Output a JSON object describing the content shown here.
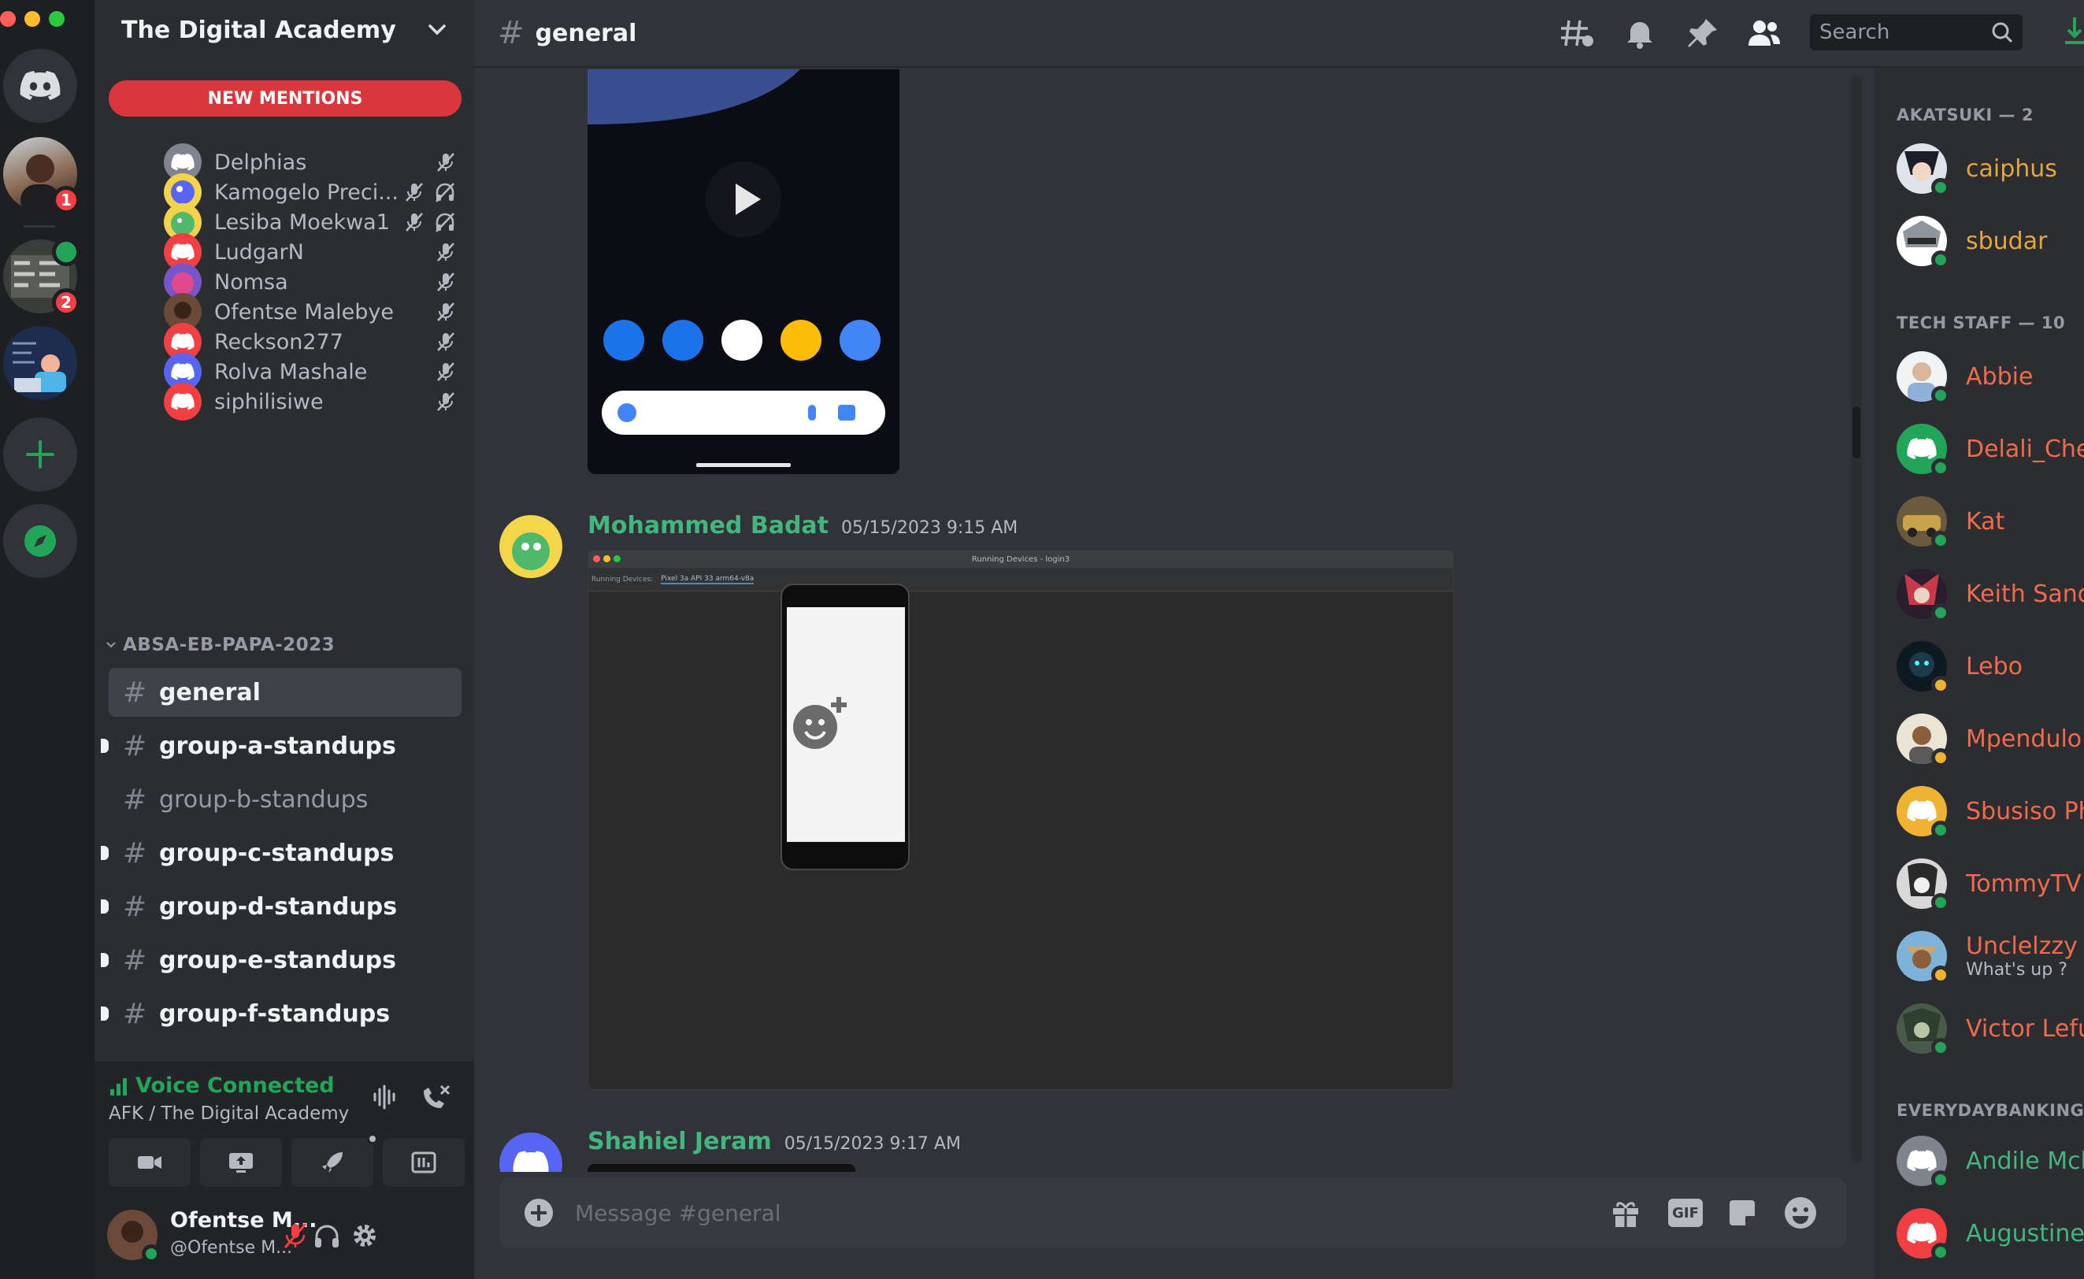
{
  "colors": {
    "accent": "#5865f2",
    "online": "#23a559",
    "idle": "#f0b232",
    "mention_red": "#da373c",
    "akatsuki_role": "#e5a543",
    "tech_staff_role": "#f06b4d",
    "everyday_role": "#43b581",
    "author_green": "#43b581"
  },
  "server": {
    "name": "The Digital Academy",
    "new_mentions": "NEW MENTIONS",
    "badges": [
      "1",
      "2"
    ]
  },
  "voice_users": [
    {
      "name": "Delphias",
      "icons": [
        "mic-muted-icon"
      ]
    },
    {
      "name": "Kamogelo Preci...",
      "icons": [
        "mic-muted-icon",
        "deafened-icon"
      ]
    },
    {
      "name": "Lesiba Moekwa1",
      "icons": [
        "mic-muted-icon",
        "deafened-icon"
      ]
    },
    {
      "name": "LudgarN",
      "icons": [
        "mic-muted-icon"
      ]
    },
    {
      "name": "Nomsa",
      "icons": [
        "mic-muted-icon"
      ]
    },
    {
      "name": "Ofentse Malebye",
      "icons": [
        "mic-muted-icon"
      ]
    },
    {
      "name": "Reckson277",
      "icons": [
        "mic-muted-icon"
      ]
    },
    {
      "name": "Rolva Mashale",
      "icons": [
        "mic-muted-icon"
      ]
    },
    {
      "name": "siphilisiwe",
      "icons": [
        "mic-muted-icon"
      ]
    }
  ],
  "category": "ABSA-EB-PAPA-2023",
  "channels": [
    {
      "name": "general",
      "state": "active"
    },
    {
      "name": "group-a-standups",
      "state": "unread"
    },
    {
      "name": "group-b-standups",
      "state": "muted"
    },
    {
      "name": "group-c-standups",
      "state": "unread"
    },
    {
      "name": "group-d-standups",
      "state": "unread"
    },
    {
      "name": "group-e-standups",
      "state": "unread"
    },
    {
      "name": "group-f-standups",
      "state": "unread"
    }
  ],
  "voice": {
    "status": "Voice Connected",
    "location": "AFK / The Digital Academy"
  },
  "user": {
    "display": "Ofentse M...",
    "tag": "@Ofentse M..."
  },
  "header": {
    "channel": "general",
    "search_placeholder": "Search"
  },
  "messages": [
    {
      "author": "Mohammed Badat",
      "timestamp": "05/15/2023 9:15 AM",
      "attachment": "screenshot",
      "window_title": "Running Devices - login3",
      "tab_label": "Running Devices:",
      "device_tab": "Pixel 3a API 33 arm64-v8a"
    },
    {
      "author": "Shahiel Jeram",
      "timestamp": "05/15/2023 9:17 AM",
      "attachment": "image"
    }
  ],
  "composer": {
    "placeholder": "Message #general",
    "gif_label": "GIF"
  },
  "member_groups": [
    {
      "label": "AKATSUKI — 2",
      "color": "#e5a543",
      "members": [
        {
          "name": "caiphus",
          "status": "online"
        },
        {
          "name": "sbudar",
          "status": "online"
        }
      ]
    },
    {
      "label": "TECH STAFF — 10",
      "color": "#f06b4d",
      "members": [
        {
          "name": "Abbie",
          "status": "online"
        },
        {
          "name": "Delali_Che",
          "status": "online"
        },
        {
          "name": "Kat",
          "status": "online"
        },
        {
          "name": "Keith Sand",
          "status": "online"
        },
        {
          "name": "Lebo",
          "status": "idle"
        },
        {
          "name": "Mpendulo",
          "status": "idle"
        },
        {
          "name": "Sbusiso Ph",
          "status": "online"
        },
        {
          "name": "TommyTV",
          "status": "online"
        },
        {
          "name": "Unclelzzy",
          "status": "idle",
          "custom_status": "What's up ?"
        },
        {
          "name": "Victor Lefu",
          "status": "online"
        }
      ]
    },
    {
      "label": "EVERYDAYBANKING -",
      "color": "#43b581",
      "members": [
        {
          "name": "Andile Mch",
          "status": "online"
        },
        {
          "name": "Augustine",
          "status": "online"
        }
      ]
    }
  ]
}
